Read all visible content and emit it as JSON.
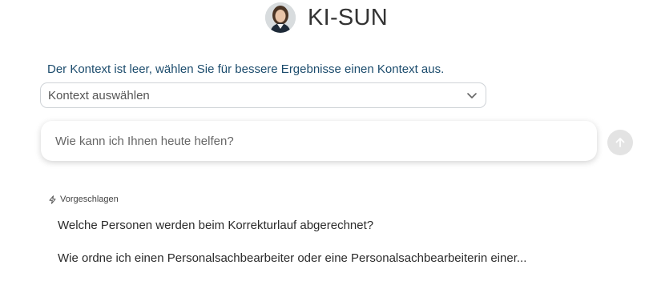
{
  "header": {
    "title": "KI-SUN",
    "avatar_icon": "person-avatar-icon"
  },
  "context": {
    "hint": "Der Kontext ist leer, wählen Sie für bessere Ergebnisse einen Kontext aus.",
    "select_value": "Kontext auswählen",
    "chevron_icon": "chevron-down-icon"
  },
  "prompt": {
    "placeholder": "Wie kann ich Ihnen heute helfen?",
    "send_icon": "arrow-up-icon"
  },
  "suggestions": {
    "heading": "Vorgeschlagen",
    "heading_icon": "lightning-icon",
    "items": [
      "Welche Personen werden beim Korrekturlauf abgerechnet?",
      "Wie ordne ich einen Personalsachbearbeiter oder eine Personalsachbearbeiterin einer..."
    ]
  },
  "colors": {
    "hint_text": "#1c4c6d",
    "send_button_bg": "#e3e3e3"
  }
}
